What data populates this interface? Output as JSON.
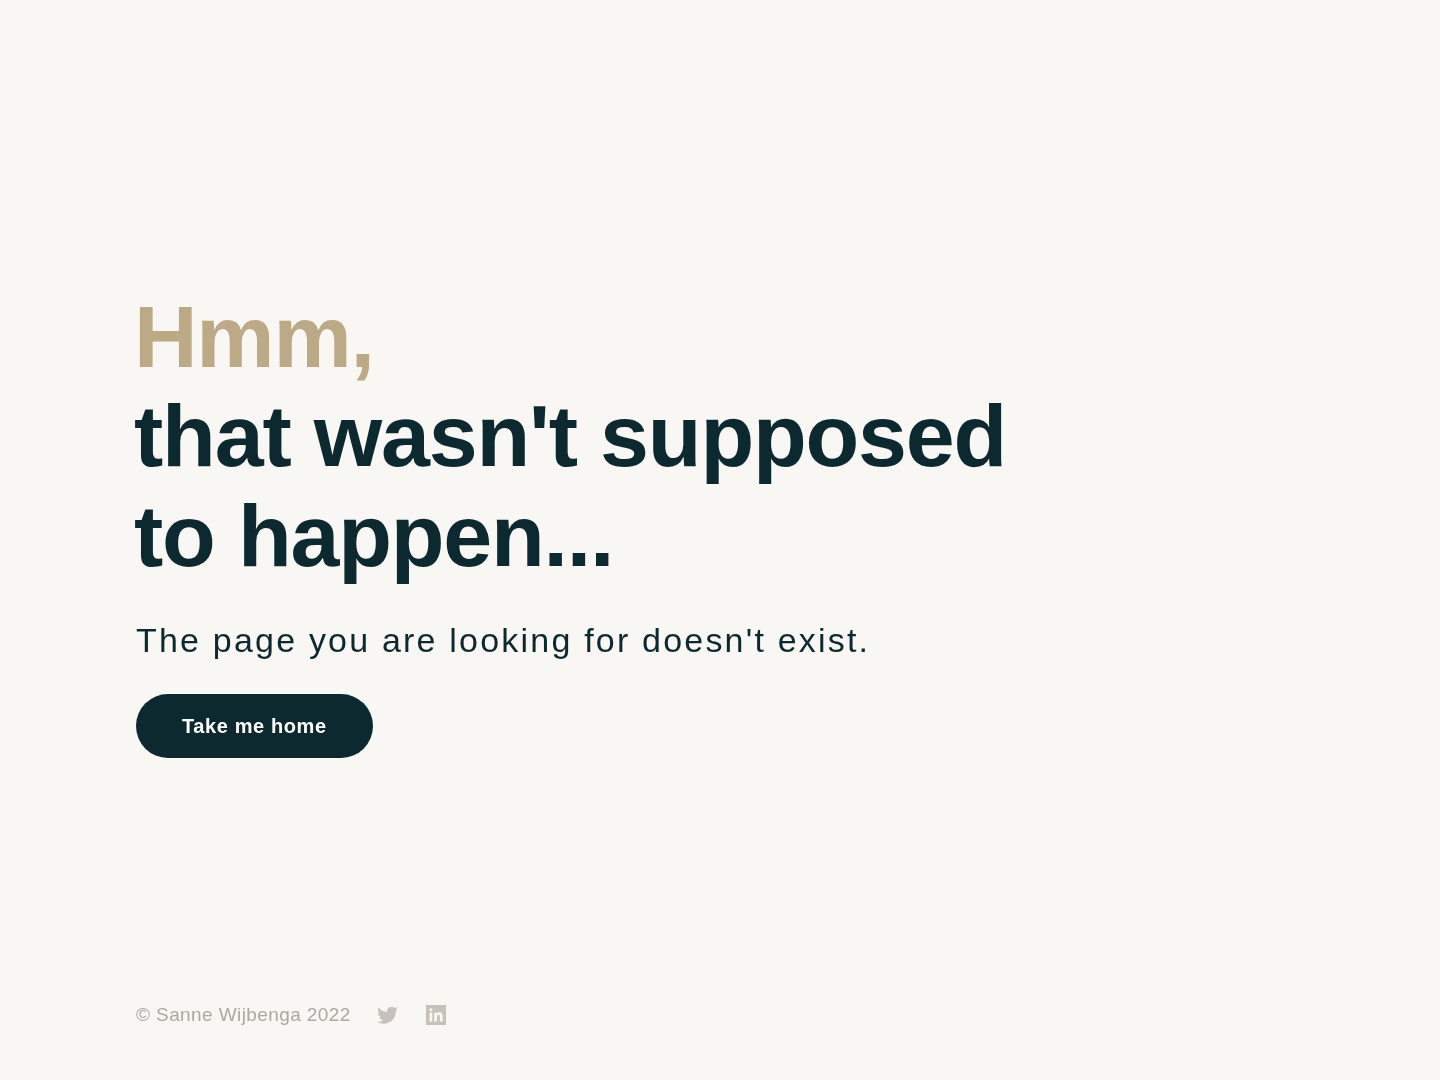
{
  "heading": {
    "lead": "Hmm,",
    "text": "that wasn't supposed to happen..."
  },
  "message": "The page you are looking for doesn't exist.",
  "button": {
    "label": "Take me home"
  },
  "footer": {
    "copyright": "© Sanne Wijbenga 2022"
  }
}
